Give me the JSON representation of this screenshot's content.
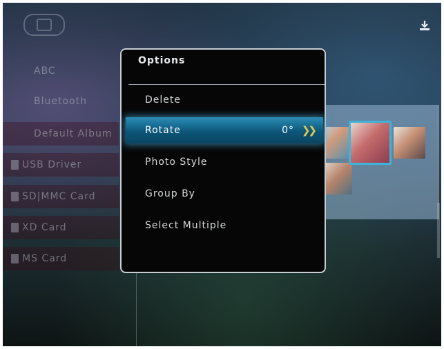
{
  "sources": [
    {
      "label": "ABC",
      "icon": ""
    },
    {
      "label": "Bluetooth",
      "icon": ""
    },
    {
      "label": "Default Album",
      "icon": ""
    },
    {
      "label": "USB Driver",
      "icon": "usb-card-icon"
    },
    {
      "label": "SD|MMC Card",
      "icon": "sd-card-icon"
    },
    {
      "label": "XD Card",
      "icon": "xd-card-icon"
    },
    {
      "label": "MS Card",
      "icon": "ms-card-icon"
    }
  ],
  "top_bar": {
    "device_icon": "device-icon",
    "download_icon": "download-icon"
  },
  "options": {
    "title": "Options",
    "items": [
      {
        "label": "Delete"
      },
      {
        "label": "Rotate",
        "value": "0°",
        "selected": true
      },
      {
        "label": "Photo Style"
      },
      {
        "label": "Group By"
      },
      {
        "label": "Select Multiple"
      }
    ]
  },
  "colors": {
    "accent": "#2b8db6",
    "chevron": "#e8c94a",
    "thumb_selected": "#3fb3d9"
  }
}
